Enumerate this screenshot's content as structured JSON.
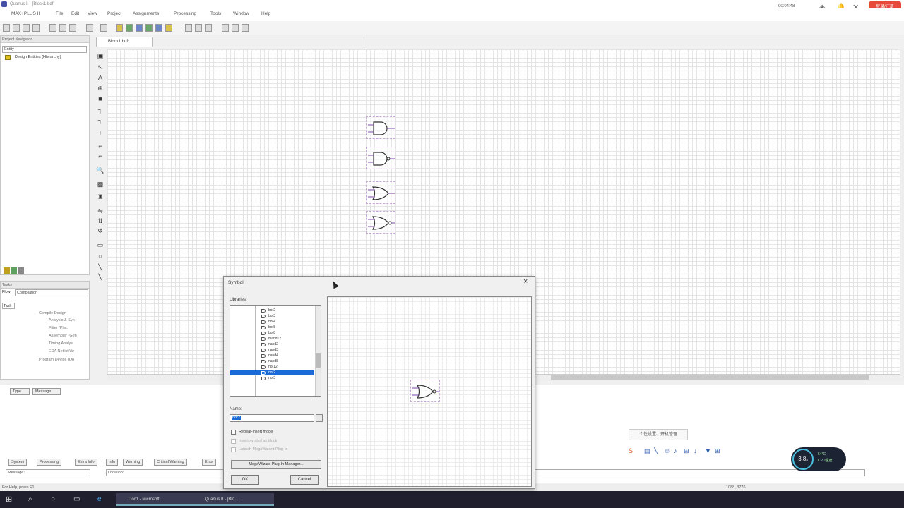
{
  "window": {
    "title": "Quartus II - [Block1.bdf]"
  },
  "menu": [
    "MAX+PLUS II",
    "File",
    "Edit",
    "View",
    "Project",
    "Assignments",
    "Processing",
    "Tools",
    "Window",
    "Help"
  ],
  "top_right": {
    "user": "00:04:48",
    "login_label": "登录/注册"
  },
  "project_navigator": {
    "title": "Project Navigator",
    "tab": "Entity",
    "item": "Design Entities (Hierarchy)"
  },
  "tasks": {
    "title": "Tasks",
    "flow_label": "Flow:",
    "flow_value": "Compilation",
    "column": "Task",
    "rows": [
      "Compile Design",
      "Analysis & Syn",
      "Fitter (Plac",
      "Assembler (Gen",
      "Timing Analysi",
      "EDA Netlist Wr",
      "Program Device (Op"
    ]
  },
  "document_tab": {
    "label": "Block1.bdf*"
  },
  "messages": {
    "col_type": "Type",
    "col_message": "Message",
    "tabs": [
      "System",
      "Processing",
      "Extra Info",
      "Info",
      "Warning",
      "Critical Warning",
      "Error"
    ],
    "filter_label": "Message:",
    "location_label": "Location:"
  },
  "statusbar": {
    "text": "For Help, press F1",
    "coords": "1088, 3776"
  },
  "dialog": {
    "title": "Symbol",
    "libraries_label": "Libraries:",
    "tree_items": [
      "bor2",
      "bor3",
      "bor4",
      "bor8",
      "bor8",
      "mand12",
      "nand2",
      "nand3",
      "nand4",
      "nand8",
      "nor12",
      "nor2",
      "nor3"
    ],
    "selected_index": 11,
    "name_label": "Name:",
    "name_value": "nor2",
    "browse": "...",
    "repeat_insert": "Repeat-insert mode",
    "insert_symbol_block": "Insert symbol as block",
    "launch_wizard": "Launch MegaWizard Plug-In",
    "megawizard_button": "MegaWizard Plug-In Manager...",
    "ok": "OK",
    "cancel": "Cancel",
    "close": "×"
  },
  "overlay": {
    "tooltip": "个性设置、开机管理",
    "perf_value": "3.8",
    "perf_unit": "s",
    "perf_temp": "54°C",
    "perf_sub": "CPU温度"
  },
  "taskbar": {
    "app1": "Doc1 - Microsoft ...",
    "app2": "Quartus II - [Blo..."
  },
  "colors": {
    "selection": "#1a6ad8",
    "canvas_grid": "#e4e4e4",
    "login_red": "#e74a3b"
  }
}
